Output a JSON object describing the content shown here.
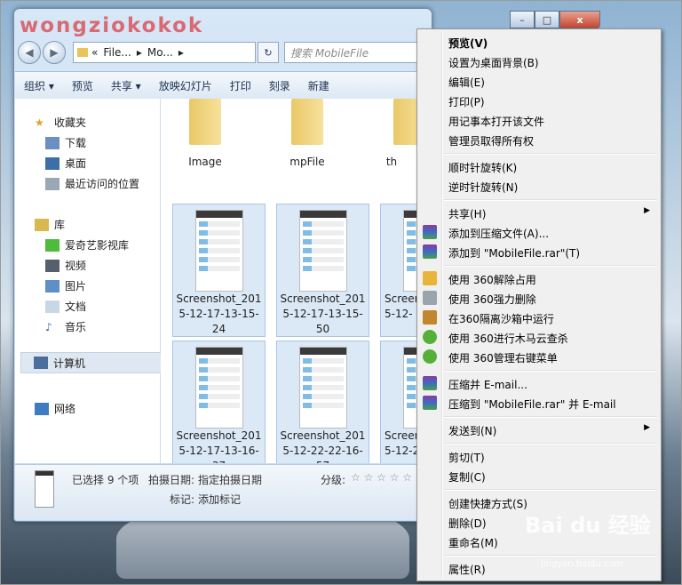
{
  "window": {
    "logo": "wongziokokok",
    "buttons": {
      "minimize": "–",
      "maximize": "□",
      "close": "x"
    }
  },
  "address": {
    "crumbs": [
      "«",
      "File...",
      "▸",
      "Mo...",
      "▸"
    ],
    "search_placeholder": "搜索 MobileFile"
  },
  "toolbar": [
    "组织 ▾",
    "预览",
    "共享 ▾",
    "放映幻灯片",
    "打印",
    "刻录",
    "新建"
  ],
  "navigation": {
    "favorites": "收藏夹",
    "fav_items": [
      "下载",
      "桌面",
      "最近访问的位置"
    ],
    "library": "库",
    "lib_items": [
      "爱奇艺影视库",
      "视频",
      "图片",
      "文档",
      "音乐"
    ],
    "computer": "计算机",
    "network": "网络"
  },
  "folders": [
    "Image",
    "mpFile",
    "th"
  ],
  "thumbnails": [
    [
      "Screenshot_201",
      "5-12-17-13-15-",
      "24"
    ],
    [
      "Screenshot_201",
      "5-12-17-13-15-",
      "50"
    ],
    [
      "Screen",
      "5-12-",
      ""
    ],
    [
      "Screenshot_201",
      "5-12-17-13-16-",
      "37"
    ],
    [
      "Screenshot_201",
      "5-12-22-22-16-",
      "57"
    ],
    [
      "Screen",
      "5-12-2",
      ""
    ]
  ],
  "details": {
    "selected": "已选择 9 个项",
    "date_label": "拍摄日期:",
    "date_value": "指定拍摄日期",
    "rating_label": "分级:",
    "rating_stars": "☆ ☆ ☆ ☆ ☆",
    "tag_label": "标记:",
    "tag_value": "添加标记"
  },
  "context_menu": [
    "预览(V)",
    "设置为桌面背景(B)",
    "编辑(E)",
    "打印(P)",
    "用记事本打开该文件",
    "管理员取得所有权",
    "顺时针旋转(K)",
    "逆时针旋转(N)",
    "共享(H)",
    "添加到压缩文件(A)...",
    "添加到 \"MobileFile.rar\"(T)",
    "使用 360解除占用",
    "使用 360强力删除",
    "在360隔离沙箱中运行",
    "使用 360进行木马云查杀",
    "使用 360管理右键菜单",
    "压缩并 E-mail...",
    "压缩到 \"MobileFile.rar\" 并 E-mail",
    "发送到(N)",
    "剪切(T)",
    "复制(C)",
    "创建快捷方式(S)",
    "删除(D)",
    "重命名(M)",
    "属性(R)"
  ],
  "watermark": {
    "logo": "Bai du 经验",
    "url": "jingyan.baidu.com"
  }
}
